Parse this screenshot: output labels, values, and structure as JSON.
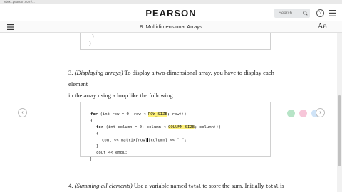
{
  "browser": {
    "url": "etext.pearson.com/..."
  },
  "header": {
    "brand": "PEARSON",
    "search_placeholder": "Search",
    "help_icon_glyph": "?"
  },
  "chapter": {
    "title": "8: Multidimensional Arrays",
    "font_icon_glyph": "Aa"
  },
  "nav": {
    "prev_glyph": "‹",
    "next_glyph": "›"
  },
  "step3": {
    "number": "3.",
    "heading": "(Displaying arrays)",
    "line1": " To display a two-dimensional array, you have to display each element",
    "line2": "in the array using a loop like the following:"
  },
  "code": {
    "line1_a": "for",
    "line1_b": " (int row = 0; row < ",
    "line1_hl": "ROW_SIZE",
    "line1_c": "; row++)",
    "line2": "{",
    "line3_a": "for",
    "line3_b": " (int column = 0; column < ",
    "line3_hl": "COLUMN_SIZE",
    "line3_c": "; column++)",
    "line4": "{",
    "line5_a": "cout << matrix[row]",
    "line5_b": "[column] << \" \";",
    "line6": "}",
    "line7": "cout << endl;",
    "line8": "}"
  },
  "highlight_colors": [
    "#b7e4c7",
    "#f7c6d9",
    "#cfe3f7"
  ],
  "step4": {
    "number": "4.",
    "heading": "(Summing all elements)",
    "text_a": " Use a variable named ",
    "var1": "total",
    "text_b": " to store the sum. Initially ",
    "var2": "total",
    "text_c": " is"
  }
}
